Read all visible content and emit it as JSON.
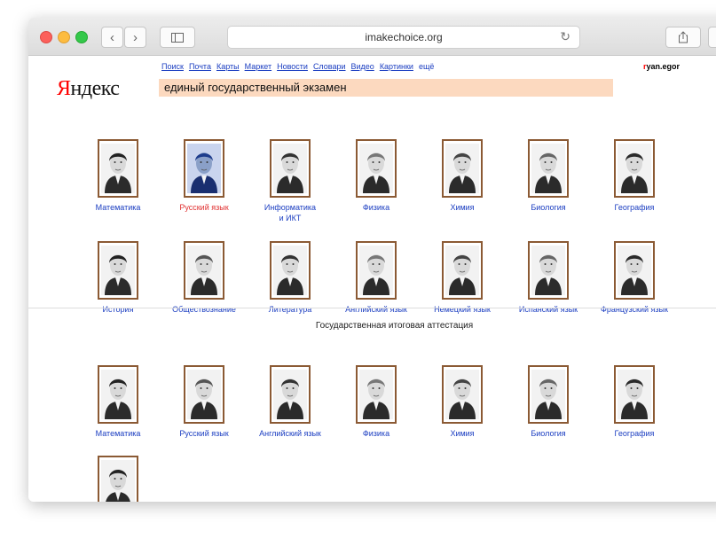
{
  "browser": {
    "url": "imakechoice.org"
  },
  "header": {
    "logo_first": "Я",
    "logo_rest": "ндекс",
    "links": [
      "Поиск",
      "Почта",
      "Карты",
      "Маркет",
      "Новости",
      "Словари",
      "Видео",
      "Картинки"
    ],
    "more_label": "ещё",
    "user_first": "r",
    "user_rest": "yan.egor",
    "search_value": "единый государственный экзамен"
  },
  "ege_subjects": [
    {
      "label": "Математика",
      "highlight": false
    },
    {
      "label": "Русский язык",
      "highlight": true
    },
    {
      "label": "Информатика\nи ИКТ",
      "highlight": false
    },
    {
      "label": "Физика",
      "highlight": false
    },
    {
      "label": "Химия",
      "highlight": false
    },
    {
      "label": "Биология",
      "highlight": false
    },
    {
      "label": "География",
      "highlight": false
    },
    {
      "label": "История",
      "highlight": false
    },
    {
      "label": "Обществознание",
      "highlight": false
    },
    {
      "label": "Литература",
      "highlight": false
    },
    {
      "label": "Английский язык",
      "highlight": false
    },
    {
      "label": "Немецкий язык",
      "highlight": false
    },
    {
      "label": "Испанский язык",
      "highlight": false
    },
    {
      "label": "Французский язык",
      "highlight": false
    }
  ],
  "gia_section_title": "Государственная итоговая аттестация",
  "gia_subjects": [
    {
      "label": "Математика"
    },
    {
      "label": "Русский язык"
    },
    {
      "label": "Английский язык"
    },
    {
      "label": "Физика"
    },
    {
      "label": "Химия"
    },
    {
      "label": "Биология"
    },
    {
      "label": "География"
    },
    {
      "label": ""
    }
  ],
  "colors": {
    "link": "#1a3dc1",
    "highlight_link": "#e03030",
    "frame": "#8b5a34",
    "search_bg": "#fcd9bf"
  }
}
